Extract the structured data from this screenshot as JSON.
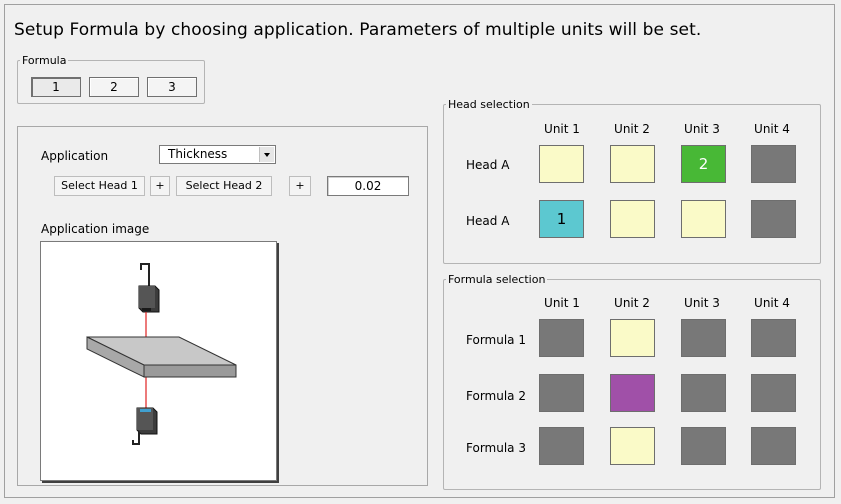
{
  "title": "Setup Formula by choosing application. Parameters of multiple units will be set.",
  "formula_group": {
    "legend": "Formula",
    "buttons": [
      "1",
      "2",
      "3"
    ]
  },
  "application": {
    "label": "Application",
    "selected": "Thickness",
    "select_head_1": "Select Head 1",
    "plus_1": "+",
    "select_head_2": "Select Head 2",
    "plus_2": "+",
    "value": "0.02",
    "image_label": "Application image"
  },
  "head_selection": {
    "legend": "Head selection",
    "units": [
      "Unit 1",
      "Unit 2",
      "Unit 3",
      "Unit 4"
    ],
    "rows": [
      {
        "label": "Head A",
        "cells": [
          {
            "state": "y",
            "text": ""
          },
          {
            "state": "y",
            "text": ""
          },
          {
            "state": "gr",
            "text": "2"
          },
          {
            "state": "g",
            "text": ""
          }
        ]
      },
      {
        "label": "Head A",
        "cells": [
          {
            "state": "c",
            "text": "1"
          },
          {
            "state": "y",
            "text": ""
          },
          {
            "state": "y",
            "text": ""
          },
          {
            "state": "g",
            "text": ""
          }
        ]
      }
    ]
  },
  "formula_selection": {
    "legend": "Formula selection",
    "units": [
      "Unit 1",
      "Unit 2",
      "Unit 3",
      "Unit 4"
    ],
    "rows": [
      {
        "label": "Formula 1",
        "cells": [
          {
            "state": "g"
          },
          {
            "state": "y"
          },
          {
            "state": "g"
          },
          {
            "state": "g"
          }
        ]
      },
      {
        "label": "Formula 2",
        "cells": [
          {
            "state": "g"
          },
          {
            "state": "p"
          },
          {
            "state": "g"
          },
          {
            "state": "g"
          }
        ]
      },
      {
        "label": "Formula 3",
        "cells": [
          {
            "state": "g"
          },
          {
            "state": "y"
          },
          {
            "state": "g"
          },
          {
            "state": "g"
          }
        ]
      }
    ]
  },
  "colors": {
    "empty": "#fafac8",
    "disabled": "#787878",
    "head_1": "#5cc8d0",
    "head_2": "#48b836",
    "formula_selected": "#a050a8"
  }
}
